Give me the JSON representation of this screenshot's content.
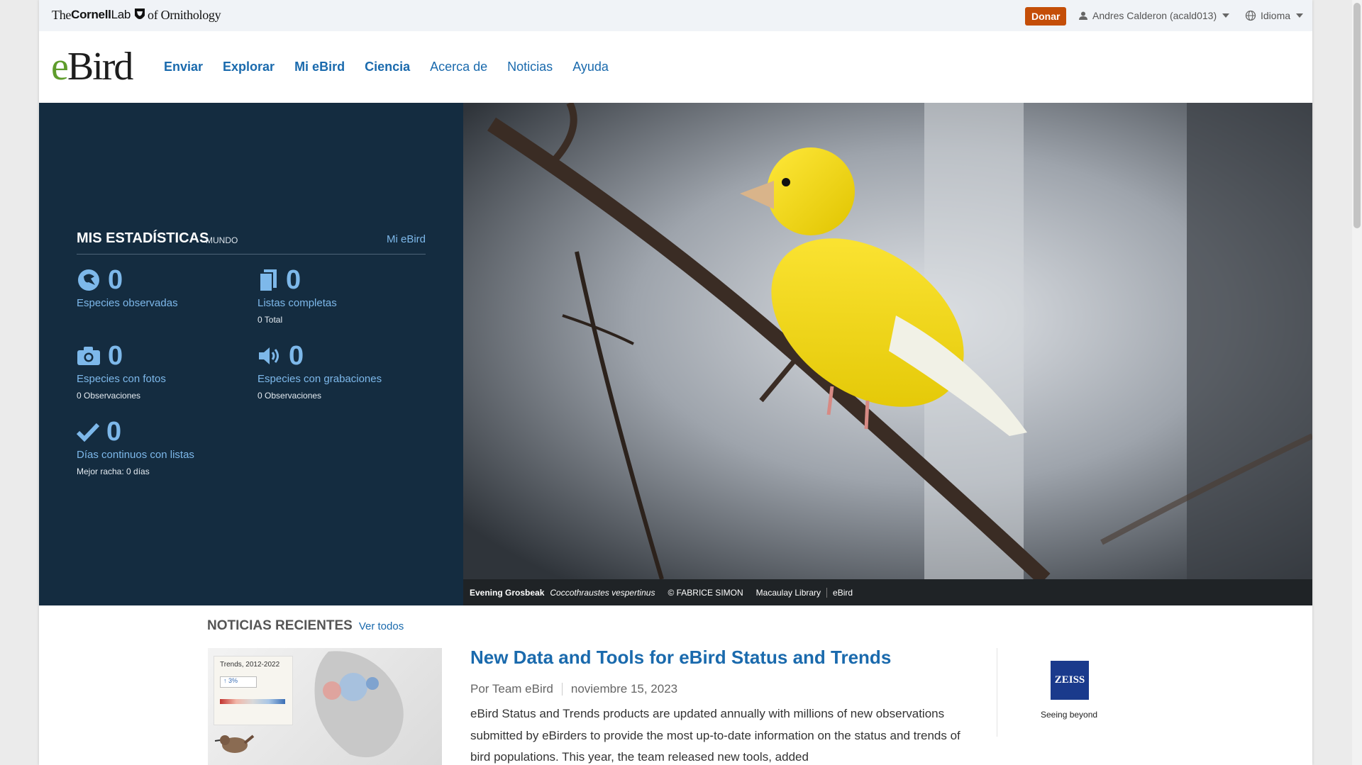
{
  "topbar": {
    "logo": {
      "the": "The",
      "cornell": "Cornell",
      "lab": "Lab",
      "of": "of Ornithology"
    },
    "donate_label": "Donar",
    "user_label": "Andres Calderon (acald013)",
    "language_label": "Idioma",
    "donate_color": "#c44e08"
  },
  "nav": {
    "logo_text": "eBird",
    "items": [
      {
        "label": "Enviar"
      },
      {
        "label": "Explorar"
      },
      {
        "label": "Mi eBird"
      },
      {
        "label": "Ciencia"
      },
      {
        "label": "Acerca de"
      },
      {
        "label": "Noticias"
      },
      {
        "label": "Ayuda"
      }
    ],
    "link_color": "#1a6aad"
  },
  "stats": {
    "title": "MIS ESTADÍSTICAS",
    "scope": "MUNDO",
    "link": "Mi eBird",
    "items": [
      {
        "value": "0",
        "label": "Especies observadas",
        "sub": "",
        "icon": "bird-icon"
      },
      {
        "value": "0",
        "label": "Listas completas",
        "sub": "0 Total",
        "icon": "checklist-icon"
      },
      {
        "value": "0",
        "label": "Especies con fotos",
        "sub": "0 Observaciones",
        "icon": "camera-icon"
      },
      {
        "value": "0",
        "label": "Especies con grabaciones",
        "sub": "0 Observaciones",
        "icon": "speaker-icon"
      },
      {
        "value": "0",
        "label": "Días continuos con listas",
        "sub": "Mejor racha: 0 días",
        "icon": "checkmark-icon"
      }
    ],
    "background": "#142c40"
  },
  "hero": {
    "species": "Evening Grosbeak",
    "scientific": "Coccothraustes vespertinus",
    "credit": "© FABRICE SIMON",
    "library": "Macaulay Library",
    "source": "eBird"
  },
  "news": {
    "section_title": "NOTICIAS RECIENTES",
    "see_all": "Ver todos",
    "thumbnail_title": "Trends, 2012-2022",
    "thumbnail_trend": "↑ 3%",
    "headline": "New Data and Tools for eBird Status and Trends",
    "author": "Por Team eBird",
    "date": "noviembre 15, 2023",
    "body": "eBird Status and Trends products are updated annually with millions of new observations submitted by eBirders to provide the most up-to-date information on the status and trends of bird populations. This year, the team released new tools, added"
  },
  "sponsor": {
    "logo_text": "ZEISS",
    "tagline": "Seeing beyond"
  }
}
